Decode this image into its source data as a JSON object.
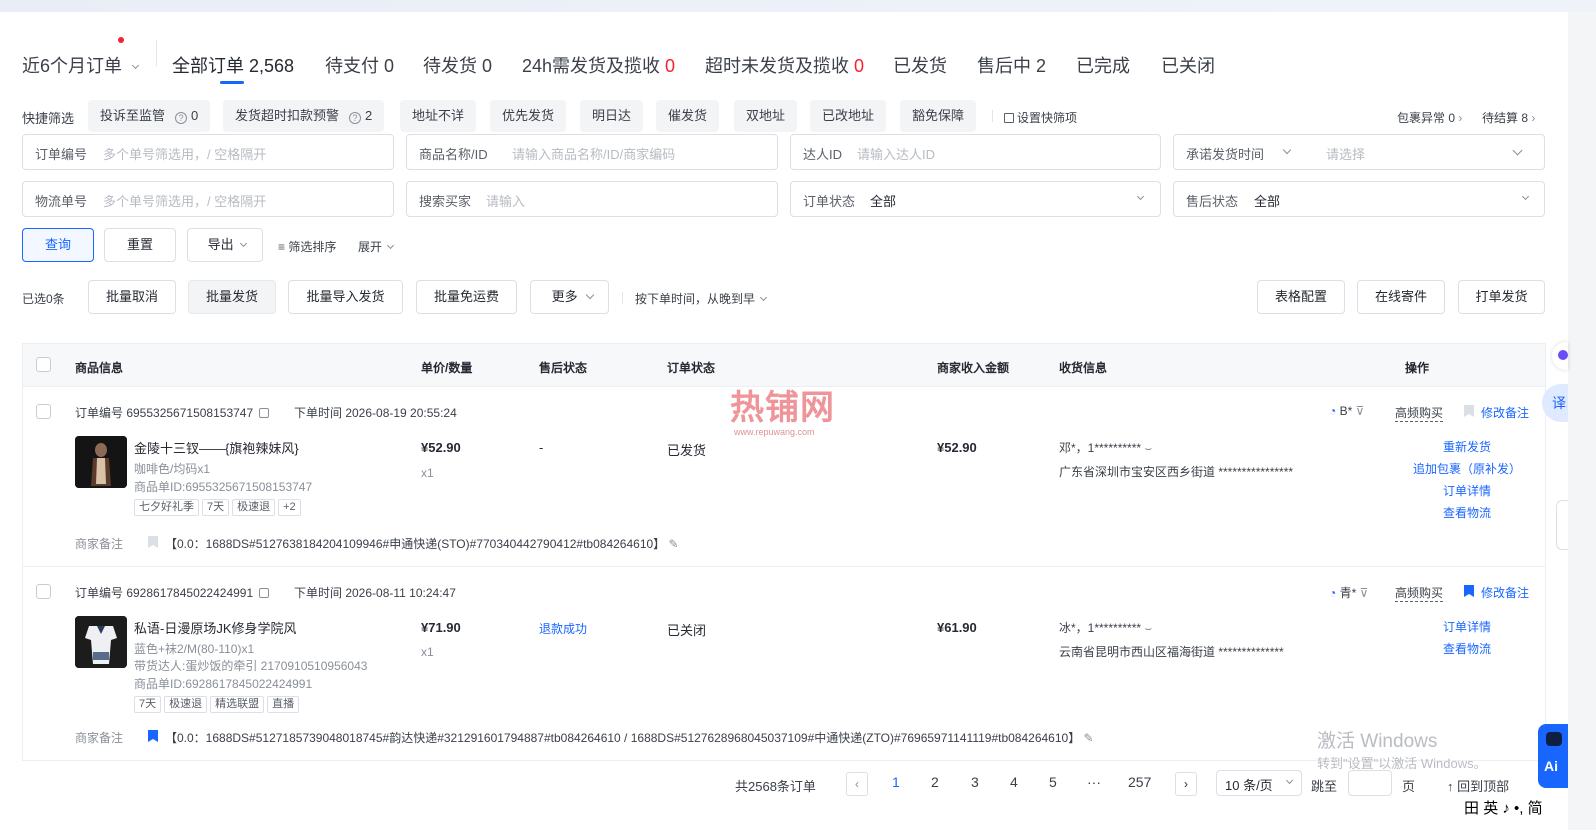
{
  "tabs": {
    "period": "近6个月订单",
    "items": [
      {
        "label": "全部订单 2,568"
      },
      {
        "label": "待支付 0"
      },
      {
        "label": "待发货 0"
      },
      {
        "label": "24h需发货及揽收 ",
        "count": "0"
      },
      {
        "label": "超时未发货及揽收 ",
        "count": "0"
      },
      {
        "label": "已发货"
      },
      {
        "label": "售后中 2"
      },
      {
        "label": "已完成"
      },
      {
        "label": "已关闭"
      }
    ]
  },
  "quick": {
    "label": "快捷筛选",
    "chips": [
      {
        "label": "投诉至监管",
        "count": "0"
      },
      {
        "label": "发货超时扣款预警",
        "count": "2"
      },
      {
        "label": "地址不详"
      },
      {
        "label": "优先发货"
      },
      {
        "label": "明日达"
      },
      {
        "label": "催发货"
      },
      {
        "label": "双地址"
      },
      {
        "label": "已改地址"
      },
      {
        "label": "豁免保障"
      }
    ],
    "settings": "设置快筛项",
    "pkg_abnormal": "包裹异常 0",
    "pending_settle": "待结算 8"
  },
  "filters": {
    "order_no": {
      "label": "订单编号",
      "placeholder": "多个单号筛选用，/ 空格隔开"
    },
    "product": {
      "label": "商品名称/ID",
      "placeholder": "请输入商品名称/ID/商家编码"
    },
    "talent": {
      "label": "达人ID",
      "placeholder": "请输入达人ID"
    },
    "promise": {
      "label": "承诺发货时间",
      "placeholder": "请选择"
    },
    "logistics": {
      "label": "物流单号",
      "placeholder": "多个单号筛选用，/ 空格隔开"
    },
    "buyer": {
      "label": "搜索买家",
      "placeholder": "请输入"
    },
    "order_status": {
      "label": "订单状态",
      "value": "全部"
    },
    "after_status": {
      "label": "售后状态",
      "value": "全部"
    }
  },
  "actions": {
    "query": "查询",
    "reset": "重置",
    "export": "导出",
    "sort": "筛选排序",
    "expand": "展开"
  },
  "batch": {
    "selected": "已选0条",
    "cancel": "批量取消",
    "ship": "批量发货",
    "import_ship": "批量导入发货",
    "free_freight": "批量免运费",
    "more": "更多",
    "order_by": "按下单时间，从晚到早",
    "table_config": "表格配置",
    "online_send": "在线寄件",
    "print_ship": "打单发货"
  },
  "columns": [
    "商品信息",
    "单价/数量",
    "售后状态",
    "订单状态",
    "商家收入金额",
    "收货信息",
    "操作"
  ],
  "orders": [
    {
      "order_no": "订单编号 6955325671508153747",
      "order_time": "下单时间 2026-08-19 20:55:24",
      "buyer_tag": "B*",
      "freq": "高频购买",
      "remark_btn": "修改备注",
      "title": "金陵十三钗——{旗袍辣妹风}",
      "spec": "咖啡色/均码x1",
      "talent": "",
      "pid": "商品单ID:6955325671508153747",
      "tags": [
        "七夕好礼季",
        "7天",
        "极速退",
        "+2"
      ],
      "price": "¥52.90",
      "qty": "x1",
      "after": "-",
      "status": "已发货",
      "income": "¥52.90",
      "recv_name": "邓*，1**********",
      "recv_addr": "广东省深圳市宝安区西乡街道 ****************",
      "ops": [
        "重新发货",
        "追加包裹（原补发）",
        "订单详情",
        "查看物流"
      ],
      "note_label": "商家备注",
      "note": "【0.0：1688DS#5127638184204109946#申通快递(STO)#770340442790412#tb084264610】",
      "flag_color": "#c9ccd3"
    },
    {
      "order_no": "订单编号 6928617845022424991",
      "order_time": "下单时间 2026-08-11 10:24:47",
      "buyer_tag": "青*",
      "freq": "高频购买",
      "remark_btn": "修改备注",
      "title": "私语-日漫原场JK修身学院风",
      "spec": "蓝色+袜2/M(80-110)x1",
      "talent": "带货达人:蛋炒饭的牵引 2170910510956043",
      "pid": "商品单ID:6928617845022424991",
      "tags": [
        "7天",
        "极速退",
        "精选联盟",
        "直播"
      ],
      "price": "¥71.90",
      "qty": "x1",
      "after": "退款成功",
      "status": "已关闭",
      "income": "¥61.90",
      "recv_name": "冰*，1**********",
      "recv_addr": "云南省昆明市西山区福海街道 **************",
      "ops": [
        "订单详情",
        "查看物流"
      ],
      "note_label": "商家备注",
      "note": "【0.0：1688DS#5127185739048018745#韵达快递#321291601794887#tb084264610 / 1688DS#5127628968045037109#中通快递(ZTO)#76965971141119#tb084264610】",
      "flag_color": "#1966ff"
    }
  ],
  "pager": {
    "total": "共2568条订单",
    "pages": [
      "1",
      "2",
      "3",
      "4",
      "5",
      "···",
      "257"
    ],
    "current": "1",
    "page_size": "10 条/页",
    "jump": "跳至",
    "page_unit": "页",
    "top": "回到顶部"
  },
  "watermark": {
    "logo": "热铺网",
    "url": "www.repuwang.com",
    "win1": "激活 Windows",
    "win2": "转到\"设置\"以激活 Windows。"
  },
  "ime": "英 ♪ •, 简",
  "colors": {
    "accent": "#1966ff",
    "red": "#f5222d"
  }
}
